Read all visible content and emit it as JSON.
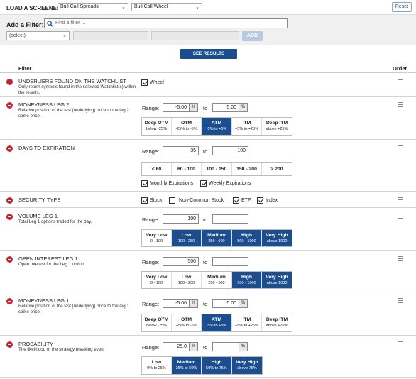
{
  "top": {
    "load_label": "LOAD A SCREENER:",
    "screener1": "Bull Call Spreads",
    "screener2": "Bull Call Wheel",
    "reset": "Reset"
  },
  "add": {
    "label": "Add a Filter:",
    "find_placeholder": "Find a filter ...",
    "select_value": "(select)",
    "add_button": "ADD"
  },
  "see_results": "SEE RESULTS",
  "header": {
    "filter": "Filter",
    "order": "Order"
  },
  "filters": {
    "watchlist": {
      "title": "UNDERLIERS FOUND ON THE WATCHLIST",
      "desc": "Only return symbols found in the selected Watchlist(s) within the results.",
      "checkbox_label": "Wheel",
      "checked": true
    },
    "moneyness2": {
      "title": "MONEYNESS LEG 2",
      "desc": "Relative position of the last (underlying) price to the leg 2 strike price.",
      "range_label": "Range:",
      "to_label": "to",
      "from": "-5.00",
      "to": "5.00",
      "unit": "%",
      "options": [
        {
          "name": "Deep OTM",
          "range": "below -25%",
          "selected": false
        },
        {
          "name": "OTM",
          "range": "-25% to -5%",
          "selected": false
        },
        {
          "name": "ATM",
          "range": "-5% to +5%",
          "selected": true
        },
        {
          "name": "ITM",
          "range": "+5% to +25%",
          "selected": false
        },
        {
          "name": "Deep ITM",
          "range": "above +25%",
          "selected": false
        }
      ]
    },
    "dte": {
      "title": "DAYS TO EXPIRATION",
      "range_label": "Range:",
      "to_label": "to",
      "from": "35",
      "to": "100",
      "options": [
        "< 60",
        "60 - 100",
        "100 - 150",
        "150 - 200",
        "> 200"
      ],
      "monthly": "Monthly Expirations",
      "weekly": "Weekly Expirations",
      "monthly_checked": true,
      "weekly_checked": true
    },
    "security": {
      "title": "SECURITY TYPE",
      "stock": "Stock",
      "noncommon": "Non-Common Stock",
      "etf": "ETF",
      "index": "Index",
      "stock_checked": true,
      "noncommon_checked": false,
      "etf_checked": true,
      "index_checked": true
    },
    "volume": {
      "title": "VOLUME LEG 1",
      "desc": "Total Leg 1 options traded for the day.",
      "range_label": "Range:",
      "to_label": "to",
      "from": "100",
      "to": "",
      "options": [
        {
          "name": "Very Low",
          "range": "0 - 100",
          "selected": false
        },
        {
          "name": "Low",
          "range": "100 - 250",
          "selected": true
        },
        {
          "name": "Medium",
          "range": "250 - 500",
          "selected": true
        },
        {
          "name": "High",
          "range": "500 - 1000",
          "selected": true
        },
        {
          "name": "Very High",
          "range": "above 1000",
          "selected": true
        }
      ]
    },
    "oi": {
      "title": "OPEN INTEREST LEG 1",
      "desc": "Open Interest for the Leg 1 option.",
      "range_label": "Range:",
      "to_label": "to",
      "from": "500",
      "to": "",
      "options": [
        {
          "name": "Very Low",
          "range": "0 - 100",
          "selected": false
        },
        {
          "name": "Low",
          "range": "100 - 250",
          "selected": false
        },
        {
          "name": "Medium",
          "range": "250 - 500",
          "selected": false
        },
        {
          "name": "High",
          "range": "500 - 1000",
          "selected": true
        },
        {
          "name": "Very High",
          "range": "above 1000",
          "selected": true
        }
      ]
    },
    "moneyness1": {
      "title": "MONEYNESS LEG 1",
      "desc": "Relative position of the last (underlying) price to the leg 1 strike price.",
      "range_label": "Range:",
      "to_label": "to",
      "from": "-5.00",
      "to": "5.00",
      "unit": "%",
      "options": [
        {
          "name": "Deep OTM",
          "range": "below -25%",
          "selected": false
        },
        {
          "name": "OTM",
          "range": "-25% to -5%",
          "selected": false
        },
        {
          "name": "ATM",
          "range": "-5% to +5%",
          "selected": true
        },
        {
          "name": "ITM",
          "range": "+5% to +25%",
          "selected": false
        },
        {
          "name": "Deep ITM",
          "range": "above +25%",
          "selected": false
        }
      ]
    },
    "probability": {
      "title": "PROBABILITY",
      "desc": "The likelihood of the strategy breaking even.",
      "range_label": "Range:",
      "to_label": "to",
      "from": "25.0",
      "to": "",
      "unit": "%",
      "options": [
        {
          "name": "Low",
          "range": "0% to 25%",
          "selected": false
        },
        {
          "name": "Medium",
          "range": "25% to 50%",
          "selected": true
        },
        {
          "name": "High",
          "range": "50% to 75%",
          "selected": true
        },
        {
          "name": "Very High",
          "range": "above 75%",
          "selected": true
        }
      ]
    }
  }
}
